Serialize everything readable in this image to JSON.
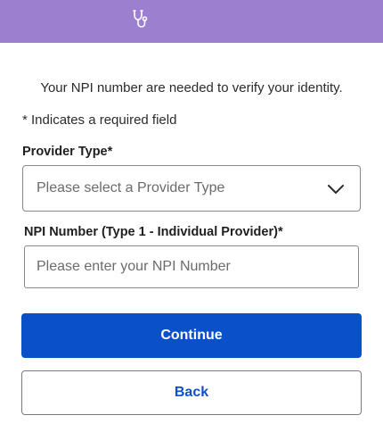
{
  "header": {
    "icon": "stethoscope-icon",
    "background_color": "#9d7fd0"
  },
  "intro_text": "Your NPI number are needed to verify your identity.",
  "required_note": "* Indicates a required field",
  "provider_type": {
    "label": "Provider Type*",
    "selected_value": "Please select a Provider Type"
  },
  "npi_number": {
    "label": "NPI Number (Type 1 - Individual Provider)*",
    "value": "",
    "placeholder": "Please enter your NPI Number"
  },
  "buttons": {
    "continue_label": "Continue",
    "back_label": "Back",
    "primary_color": "#0a51c9"
  }
}
